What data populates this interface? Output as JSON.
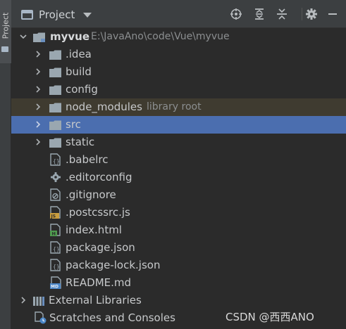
{
  "side_panel": {
    "tab_label": "Project"
  },
  "header": {
    "title": "Project",
    "icons": [
      "locate-icon",
      "expand-all-icon",
      "collapse-all-icon",
      "gear-icon",
      "minimize-icon"
    ]
  },
  "tree": {
    "root": {
      "name": "myvue",
      "path": "E:\\JavaAno\\code\\Vue\\myvue"
    },
    "folders": [
      {
        "name": ".idea"
      },
      {
        "name": "build"
      },
      {
        "name": "config"
      },
      {
        "name": "node_modules",
        "note": "library root"
      },
      {
        "name": "src"
      },
      {
        "name": "static"
      }
    ],
    "files": [
      {
        "name": ".babelrc",
        "icon": "json-file-icon"
      },
      {
        "name": ".editorconfig",
        "icon": "gear-file-icon"
      },
      {
        "name": ".gitignore",
        "icon": "ignore-file-icon"
      },
      {
        "name": ".postcssrc.js",
        "icon": "js-file-icon"
      },
      {
        "name": "index.html",
        "icon": "html-file-icon"
      },
      {
        "name": "package.json",
        "icon": "json-file-icon"
      },
      {
        "name": "package-lock.json",
        "icon": "json-file-icon"
      },
      {
        "name": "README.md",
        "icon": "md-file-icon"
      }
    ],
    "external_libraries": "External Libraries",
    "scratches": "Scratches and Consoles"
  },
  "watermark": "CSDN @西西ANO",
  "colors": {
    "selection": "#4b6eaf",
    "library_row": "#3f3b30",
    "folder": "#9aa7b0"
  }
}
